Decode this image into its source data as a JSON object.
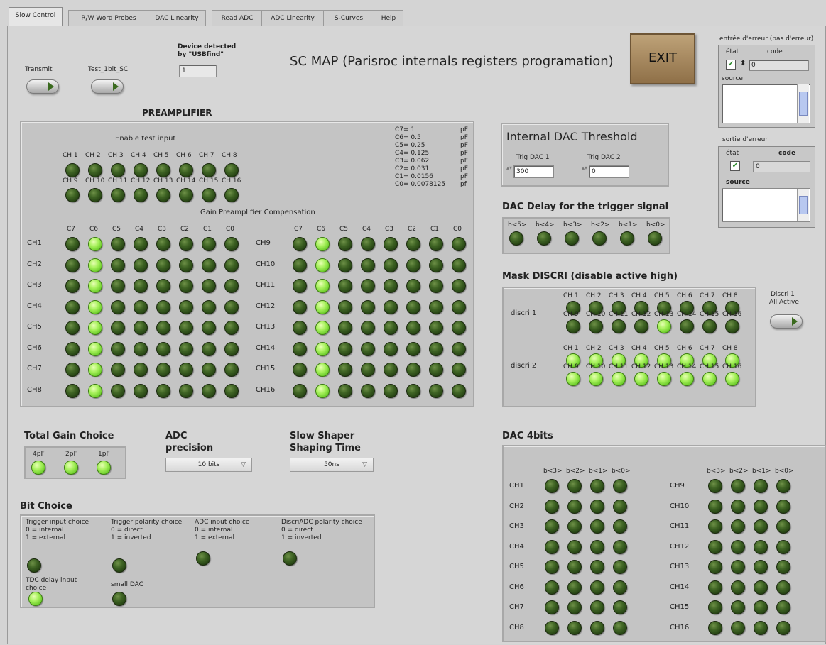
{
  "tabs": [
    "Slow Control",
    "R/W Word Probes",
    "DAC Linearity",
    "Read ADC",
    "ADC Linearity",
    "S-Curves",
    "Help"
  ],
  "header": {
    "transmit_label": "Transmit",
    "test_label": "Test_1bit_SC",
    "device_label_1": "Device detected",
    "device_label_2": "by \"USBfind\"",
    "device_value": "1",
    "title": "SC MAP (Parisroc internals registers programation)",
    "exit_label": "EXIT"
  },
  "error_in": {
    "title": "entrée d'erreur (pas d'erreur)",
    "etat": "état",
    "code": "code",
    "code_value": "0",
    "source": "source"
  },
  "error_out": {
    "title": "sortie d'erreur",
    "etat": "état",
    "code": "code",
    "code_value": "0",
    "source": "source"
  },
  "preamp": {
    "title": "PREAMPLIFIER",
    "enable_label": "Enable test input",
    "ch_row1": [
      "CH 1",
      "CH 2",
      "CH 3",
      "CH 4",
      "CH 5",
      "CH 6",
      "CH 7",
      "CH 8"
    ],
    "ch_row2": [
      "CH 9",
      "CH 10",
      "CH 11",
      "CH 12",
      "CH 13",
      "CH 14",
      "CH 15",
      "CH 16"
    ],
    "cap_names": [
      "C7= 1",
      "C6= 0.5",
      "C5= 0.25",
      "C4= 0.125",
      "C3= 0.062",
      "C2= 0.031",
      "C1= 0.0156",
      "C0= 0.0078125"
    ],
    "cap_units": [
      "pF",
      "pF",
      "pF",
      "pF",
      "pF",
      "pF",
      "pF",
      "pf"
    ],
    "gain_label": "Gain Preamplifier Compensation",
    "bit_headers": [
      "C7",
      "C6",
      "C5",
      "C4",
      "C3",
      "C2",
      "C1",
      "C0"
    ],
    "left_channels": [
      "CH1",
      "CH2",
      "CH3",
      "CH4",
      "CH5",
      "CH6",
      "CH7",
      "CH8"
    ],
    "right_channels": [
      "CH9",
      "CH10",
      "CH11",
      "CH12",
      "CH13",
      "CH14",
      "CH15",
      "CH16"
    ],
    "gain_on_column": 1
  },
  "dac_threshold": {
    "title": "Internal DAC Threshold",
    "dac1_label": "Trig DAC 1",
    "dac1_value": "300",
    "dac2_label": "Trig DAC 2",
    "dac2_value": "0"
  },
  "dac_delay": {
    "title": "DAC Delay for the trigger signal",
    "bits": [
      "b<5>",
      "b<4>",
      "b<3>",
      "b<2>",
      "b<1>",
      "b<0>"
    ]
  },
  "mask": {
    "title": "Mask DISCRI (disable active high)",
    "discri1_label": "discri 1",
    "discri2_label": "discri 2",
    "ch_row1": [
      "CH 1",
      "CH 2",
      "CH 3",
      "CH 4",
      "CH 5",
      "CH 6",
      "CH 7",
      "CH 8"
    ],
    "ch_row2": [
      "CH 9",
      "CH 10",
      "CH 11",
      "CH 12",
      "CH 13",
      "CH 14",
      "CH 15",
      "CH 16"
    ],
    "discri1_on": [
      12
    ],
    "discri2_all_on": true,
    "toggle_label_1": "Discri 1",
    "toggle_label_2": "All Active"
  },
  "total_gain": {
    "title": "Total Gain Choice",
    "options": [
      "4pF",
      "2pF",
      "1pF"
    ]
  },
  "adc": {
    "title_1": "ADC",
    "title_2": "precision",
    "value": "10 bits"
  },
  "shaper": {
    "title_1": "Slow Shaper",
    "title_2": "Shaping Time",
    "value": "50ns"
  },
  "bit_choice": {
    "title": "Bit Choice",
    "items": [
      {
        "l1": "Trigger input choice",
        "l2": "0 = internal",
        "l3": "1 = external",
        "on": false
      },
      {
        "l1": "Trigger polarity choice",
        "l2": "0 = direct",
        "l3": "1 = inverted",
        "on": false
      },
      {
        "l1": "ADC input choice",
        "l2": "0 = internal",
        "l3": "1 = external",
        "on": false
      },
      {
        "l1": "DiscriADC polarity choice",
        "l2": "0 = direct",
        "l3": "1 = inverted",
        "on": false
      }
    ],
    "tdc_l1": "TDC delay input",
    "tdc_l2": "choice",
    "small_dac": "small DAC"
  },
  "dac4": {
    "title": "DAC 4bits",
    "bits": [
      "b<3>",
      "b<2>",
      "b<1>",
      "b<0>"
    ],
    "left_channels": [
      "CH1",
      "CH2",
      "CH3",
      "CH4",
      "CH5",
      "CH6",
      "CH7",
      "CH8"
    ],
    "right_channels": [
      "CH9",
      "CH10",
      "CH11",
      "CH12",
      "CH13",
      "CH14",
      "CH15",
      "CH16"
    ]
  },
  "colors": {
    "led_on": "#a5f05a",
    "led_off": "#3f6424",
    "exit_bg": "#a88a60",
    "panel": "#c4c4c4"
  }
}
